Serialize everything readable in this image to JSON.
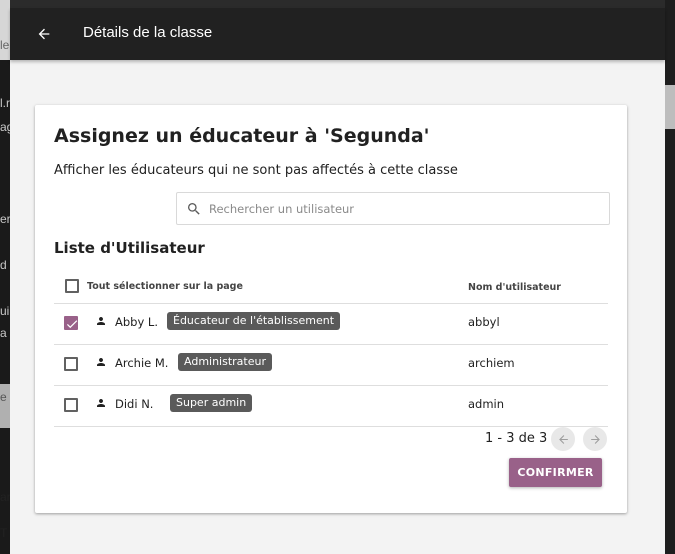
{
  "background": {
    "left_fragments": [
      "le",
      "l.r",
      "ag",
      "er",
      "d",
      "ui",
      "a",
      "e",
      "ar",
      "T"
    ]
  },
  "appbar": {
    "title": "Détails de la classe",
    "back_icon": "arrow-left-icon"
  },
  "card": {
    "title": "Assignez un éducateur à 'Segunda'",
    "subtitle": "Afficher les éducateurs qui ne sont pas affectés à cette classe",
    "search": {
      "placeholder": "Rechercher un utilisateur",
      "value": ""
    },
    "list_title": "Liste d'Utilisateur",
    "table": {
      "select_all_label": "Tout sélectionner sur la page",
      "username_header": "Nom d'utilisateur",
      "rows": [
        {
          "name": "Abby L.",
          "role": "Éducateur de l'établissement",
          "username": "abbyl",
          "checked": true
        },
        {
          "name": "Archie M.",
          "role": "Administrateur",
          "username": "archiem",
          "checked": false
        },
        {
          "name": "Didi N.",
          "role": "Super admin",
          "username": "admin",
          "checked": false
        }
      ]
    },
    "pagination": {
      "label": "1 - 3 de 3"
    },
    "confirm_label": "CONFIRMER"
  },
  "colors": {
    "accent": "#996189",
    "appbar": "#212121",
    "badge": "#5a5a5a"
  }
}
